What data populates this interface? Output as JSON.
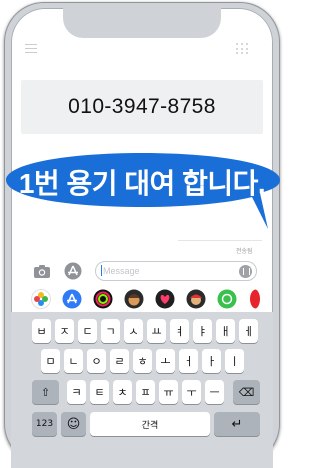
{
  "phone_number": "010-3947-8758",
  "bubble": {
    "text": "1번 용기 대여 합니다.",
    "color": "#1a6ed8"
  },
  "sender_label": "전송됨",
  "compose": {
    "placeholder": "Message"
  },
  "apps": [
    {
      "name": "photos-app-icon",
      "color": "#ffffff"
    },
    {
      "name": "app-store-icon",
      "color": "#2f7bf5"
    },
    {
      "name": "activity-icon",
      "color": "#111111"
    },
    {
      "name": "memoji-icon",
      "color": "#2b2b2b"
    },
    {
      "name": "digital-touch-icon",
      "color": "#1f1f1f"
    },
    {
      "name": "memoji-stickers-icon",
      "color": "#2b2b2b"
    },
    {
      "name": "green-app-icon",
      "color": "#39c04d"
    },
    {
      "name": "red-app-icon",
      "color": "#e6242b"
    }
  ],
  "keyboard": {
    "row1": [
      "ㅂ",
      "ㅈ",
      "ㄷ",
      "ㄱ",
      "ㅅ",
      "ㅛ",
      "ㅕ",
      "ㅑ",
      "ㅐ",
      "ㅔ"
    ],
    "row2": [
      "ㅁ",
      "ㄴ",
      "ㅇ",
      "ㄹ",
      "ㅎ",
      "ㅗ",
      "ㅓ",
      "ㅏ",
      "ㅣ"
    ],
    "row3": [
      "ㅋ",
      "ㅌ",
      "ㅊ",
      "ㅍ",
      "ㅠ",
      "ㅜ",
      "ㅡ"
    ],
    "shift_label": "⇧",
    "delete_label": "⌫",
    "numbers_label": "123",
    "emoji_label": "☺",
    "space_label": "간격",
    "return_label": "↵"
  }
}
